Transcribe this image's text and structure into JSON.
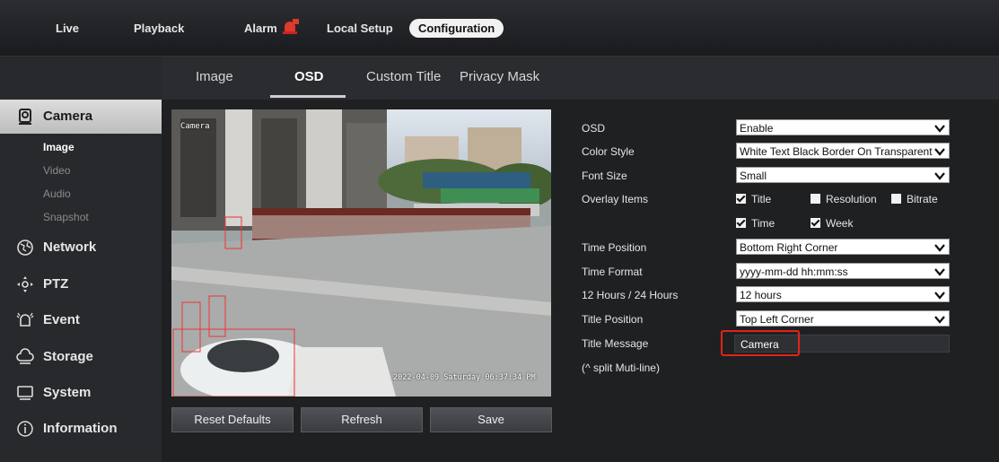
{
  "topnav": {
    "live": "Live",
    "playback": "Playback",
    "alarm": "Alarm",
    "local_setup": "Local Setup",
    "configuration": "Configuration"
  },
  "tabs": [
    "Image",
    "OSD",
    "Custom Title",
    "Privacy Mask"
  ],
  "active_tab": "OSD",
  "sidebar": {
    "camera": "Camera",
    "camera_subitems": [
      "Image",
      "Video",
      "Audio",
      "Snapshot"
    ],
    "active_subitem": "Image",
    "network": "Network",
    "ptz": "PTZ",
    "event": "Event",
    "storage": "Storage",
    "system": "System",
    "information": "Information"
  },
  "video": {
    "overlay_title": "Camera",
    "overlay_time": "2022-04-09 Saturday 06:37:34 PM"
  },
  "buttons": {
    "reset": "Reset Defaults",
    "refresh": "Refresh",
    "save": "Save"
  },
  "form": {
    "osd_label": "OSD",
    "osd_value": "Enable",
    "color_style_label": "Color Style",
    "color_style_value": "White Text Black Border On Transparent",
    "font_size_label": "Font Size",
    "font_size_value": "Small",
    "overlay_items_label": "Overlay Items",
    "overlay_title": "Title",
    "overlay_resolution": "Resolution",
    "overlay_bitrate": "Bitrate",
    "overlay_time": "Time",
    "overlay_week": "Week",
    "time_position_label": "Time Position",
    "time_position_value": "Bottom Right Corner",
    "time_format_label": "Time Format",
    "time_format_value": "yyyy-mm-dd hh:mm:ss",
    "hours_label": "12 Hours / 24 Hours",
    "hours_value": "12 hours",
    "title_position_label": "Title Position",
    "title_position_value": "Top Left Corner",
    "title_message_label": "Title Message",
    "title_message_value": "Camera",
    "split_hint": "(^ split Muti-line)"
  },
  "colors": {
    "highlight": "#e0231b",
    "background": "#1e1e20"
  }
}
